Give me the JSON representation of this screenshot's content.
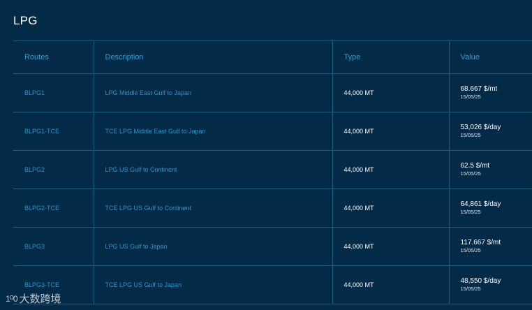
{
  "page": {
    "title": "LPG"
  },
  "table": {
    "headers": {
      "routes": "Routes",
      "description": "Description",
      "type": "Type",
      "value": "Value"
    },
    "rows": [
      {
        "route": "BLPG1",
        "description": "LPG Middle East Gulf to Japan",
        "type": "44,000 MT",
        "value": "68.667 $/mt",
        "date": "15/05/25"
      },
      {
        "route": "BLPG1-TCE",
        "description": "TCE LPG Middle East Gulf to Japan",
        "type": "44,000 MT",
        "value": "53,026 $/day",
        "date": "15/05/25"
      },
      {
        "route": "BLPG2",
        "description": "LPG US Gulf to Continent",
        "type": "44,000 MT",
        "value": "62.5 $/mt",
        "date": "15/05/25"
      },
      {
        "route": "BLPG2-TCE",
        "description": "TCE LPG US Gulf to Continent",
        "type": "44,000 MT",
        "value": "64,861 $/day",
        "date": "15/05/25"
      },
      {
        "route": "BLPG3",
        "description": "LPG US Gulf to Japan",
        "type": "44,000 MT",
        "value": "117.667 $/mt",
        "date": "15/05/25"
      },
      {
        "route": "BLPG3-TCE",
        "description": "TCE LPG US Gulf to Japan",
        "type": "44,000 MT",
        "value": "48,550 $/day",
        "date": "15/05/25"
      }
    ]
  },
  "watermark": {
    "logo": "1ᴼ0",
    "text": "大数跨境"
  }
}
